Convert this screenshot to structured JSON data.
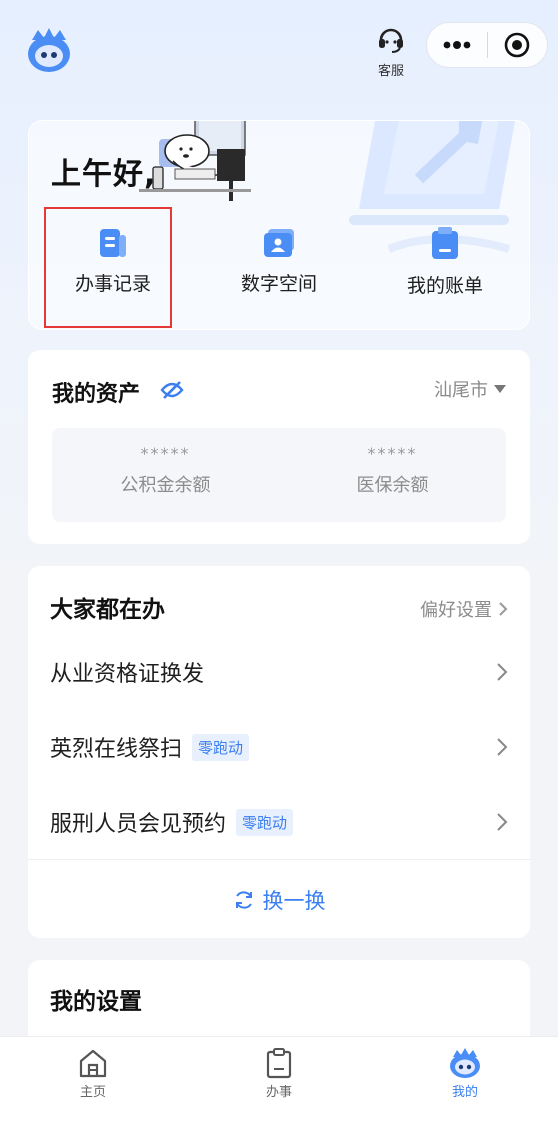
{
  "header": {
    "customer_service_label": "客服"
  },
  "greeting": {
    "text": "上午好,",
    "quick_actions": [
      {
        "label": "办事记录",
        "icon": "document-icon"
      },
      {
        "label": "数字空间",
        "icon": "id-card-icon"
      },
      {
        "label": "我的账单",
        "icon": "clipboard-icon"
      }
    ]
  },
  "assets": {
    "title": "我的资产",
    "city": "汕尾市",
    "items": [
      {
        "masked_value": "*****",
        "label": "公积金余额"
      },
      {
        "masked_value": "*****",
        "label": "医保余额"
      }
    ]
  },
  "popular": {
    "title": "大家都在办",
    "preference_label": "偏好设置",
    "items": [
      {
        "label": "从业资格证换发",
        "tag": ""
      },
      {
        "label": "英烈在线祭扫",
        "tag": "零跑动"
      },
      {
        "label": "服刑人员会见预约",
        "tag": "零跑动"
      }
    ],
    "refresh_label": "换一换"
  },
  "settings": {
    "title": "我的设置"
  },
  "bottom_nav": [
    {
      "label": "主页",
      "icon": "home-icon",
      "active": false
    },
    {
      "label": "办事",
      "icon": "clipboard-icon",
      "active": false
    },
    {
      "label": "我的",
      "icon": "mascot-icon",
      "active": true
    }
  ],
  "colors": {
    "accent": "#3b7ff0",
    "highlight_box": "#e53935"
  }
}
